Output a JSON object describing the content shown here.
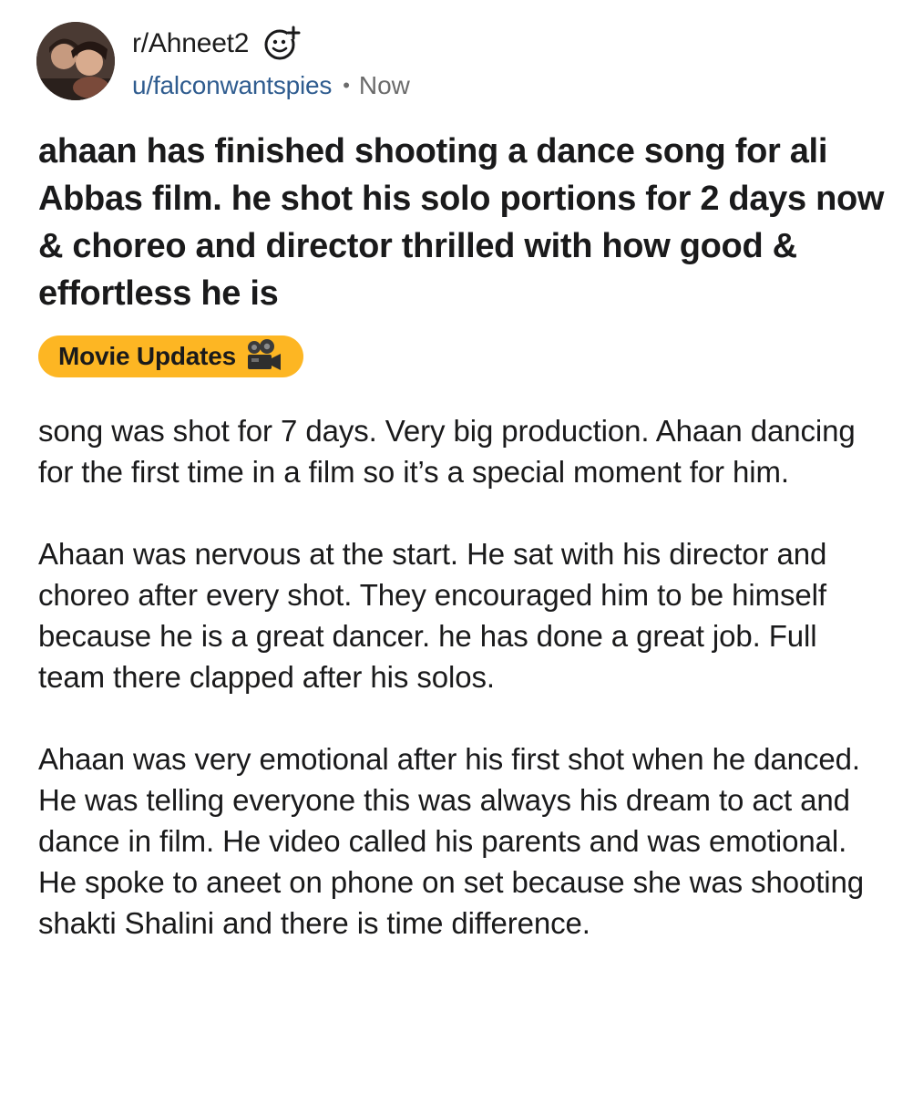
{
  "post": {
    "subreddit": "r/Ahneet2",
    "username": "u/falconwantspies",
    "separator": "•",
    "time": "Now",
    "title": "ahaan has finished shooting a dance song for ali Abbas film. he shot his solo portions for 2 days now & choreo and director thrilled with how good & effortless he is",
    "flair": {
      "label": "Movie Updates",
      "icon": "movie-camera-icon",
      "color": "#fdb623"
    },
    "body": [
      "song was shot for 7 days. Very big production. Ahaan dancing for the first time in a film so it’s a special moment for him.",
      "Ahaan was nervous at the start. He sat with his director and choreo after every shot. They encouraged him to be himself because he is a great dancer. he has done a great job. Full team there clapped after his solos.",
      "Ahaan was very emotional after his first shot when he danced. He was telling everyone this was always his dream to act and dance in film. He video called his parents and was emotional. He spoke to aneet on phone on set because she was shooting shakti Shalini and there is time difference."
    ]
  },
  "icons": {
    "join": "smiley-plus-icon",
    "avatar": "subreddit-avatar"
  },
  "colors": {
    "username": "#2f5c8f",
    "meta_gray": "#6b6b6b",
    "text": "#1a1a1b"
  }
}
